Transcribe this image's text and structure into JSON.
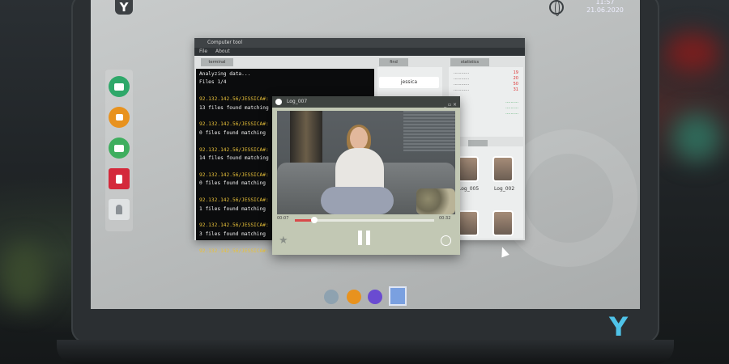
{
  "window": {
    "title": "Computer tool",
    "menu": [
      "File",
      "About"
    ]
  },
  "terminal": {
    "tab": "terminal",
    "lines": [
      {
        "text": "Analyzing data...",
        "color": "w"
      },
      {
        "text": "Files 1/4",
        "color": "w"
      },
      {
        "text": "",
        "color": "w"
      },
      {
        "text": "92.132.142.56/JESSICA#: search msg jessica",
        "color": "y"
      },
      {
        "text": "13 files found matching",
        "color": "w"
      },
      {
        "text": "",
        "color": "w"
      },
      {
        "text": "92.132.142.56/JESSICA#: ...",
        "color": "y"
      },
      {
        "text": "0 files found matching",
        "color": "w"
      },
      {
        "text": "",
        "color": "w"
      },
      {
        "text": "92.132.142.56/JESSICA#: ...",
        "color": "y"
      },
      {
        "text": "14 files found matching",
        "color": "w"
      },
      {
        "text": "",
        "color": "w"
      },
      {
        "text": "92.132.142.56/JESSICA#: ...",
        "color": "y"
      },
      {
        "text": "0 files found matching",
        "color": "w"
      },
      {
        "text": "",
        "color": "w"
      },
      {
        "text": "92.132.142.56/JESSICA#: ...",
        "color": "y"
      },
      {
        "text": "1 files found matching",
        "color": "w"
      },
      {
        "text": "",
        "color": "w"
      },
      {
        "text": "92.132.142.56/JESSICA#: ...",
        "color": "y"
      },
      {
        "text": "3 files found matching",
        "color": "w"
      },
      {
        "text": "",
        "color": "w"
      },
      {
        "text": "92.132.142.56/JESSICA#: ...",
        "color": "y"
      }
    ]
  },
  "find_panel": {
    "tab": "find",
    "button": "jessica"
  },
  "stats_panel": {
    "tab": "statistics",
    "rows": [
      {
        "label": "............",
        "value": "19"
      },
      {
        "label": "............",
        "value": "20"
      },
      {
        "label": "............",
        "value": "50"
      },
      {
        "label": "............",
        "value": "31"
      }
    ],
    "links": [
      "..........",
      "..........",
      ".........."
    ]
  },
  "media_panel": {
    "items": [
      "Log_005",
      "Log_002"
    ]
  },
  "player": {
    "title": "Log_007",
    "controls": "_ ▫ ×",
    "time_current": "00:07",
    "time_total": "00:32",
    "progress": 0.14
  },
  "clock": {
    "time": "11:57",
    "date": "21.06.2020"
  },
  "logo_text": "Y",
  "colors": {
    "accent": "#4fc3e8",
    "terminal_yellow": "#e8c13a",
    "progress_red": "#d84a4a",
    "dock_chat": "#2fa86a",
    "dock_lock": "#e8921e",
    "dock_mail": "#3eae5e",
    "dock_doc": "#d4293b",
    "dock_contact": "#9aa0a4"
  }
}
